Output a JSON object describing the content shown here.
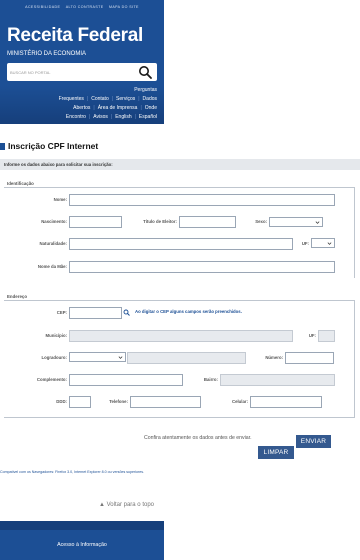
{
  "header": {
    "utility_links": [
      "ACESSIBILIDADE",
      "ALTO CONTRASTE",
      "MAPA DO SITE"
    ],
    "brand": "Receita Federal",
    "ministry": "MINISTÉRIO DA ECONOMIA",
    "search_placeholder": "BUSCAR NO PORTAL",
    "nav": {
      "frequent_questions_1": "Perguntas",
      "frequent_questions_2": "Frequentes",
      "frequent_questions_3": "Encontro",
      "contact": "Contato",
      "services_1": "Serviços",
      "services_2": "Abertos",
      "press_area": "Área de Imprensa",
      "notices": "Avisos",
      "where_1": "Onde",
      "where_2": "Dados",
      "english": "English",
      "espanol": "Español"
    }
  },
  "page": {
    "title": "Inscrição CPF Internet",
    "intro": "Informe os dados abaixo para solicitar sua inscrição:"
  },
  "identificacao": {
    "legend": "Identificação",
    "nome_label": "Nome:",
    "nascimento_label": "Nascimento:",
    "titulo_eleitor_label": "Título de Eleitor:",
    "sexo_label": "Sexo:",
    "naturalidade_label": "Naturalidade:",
    "uf_label": "UF:",
    "nome_mae_label": "Nome da Mãe:"
  },
  "endereco": {
    "legend": "Endereço",
    "cep_label": "CEP:",
    "cep_hint": "Ao digitar o CEP alguns campos serão preenchidos.",
    "municipio_label": "Município:",
    "uf_label": "UF:",
    "logradouro_label": "Logradouro:",
    "numero_label": "Número:",
    "complemento_label": "Complemento:",
    "bairro_label": "Bairro:",
    "ddd_label": "DDD:",
    "telefone_label": "Telefone:",
    "celular_label": "Celular:"
  },
  "actions": {
    "confirm_text": "Confira atentamente os dados antes de enviar.",
    "send": "ENVIAR",
    "clear": "LIMPAR"
  },
  "compat_note": "Compatível com os Navegadores: Firefox 3.0, Internet Explorer 8.0 ou versões superiores.",
  "back_to_top": "Voltar para o topo",
  "footer": {
    "link": "Acesso à Informação"
  },
  "colors": {
    "brand_blue": "#1c4f95",
    "button_blue": "#34598f"
  },
  "icons": [
    "search-icon",
    "cep-search-icon",
    "chevron-down-icon",
    "arrow-up-icon"
  ]
}
